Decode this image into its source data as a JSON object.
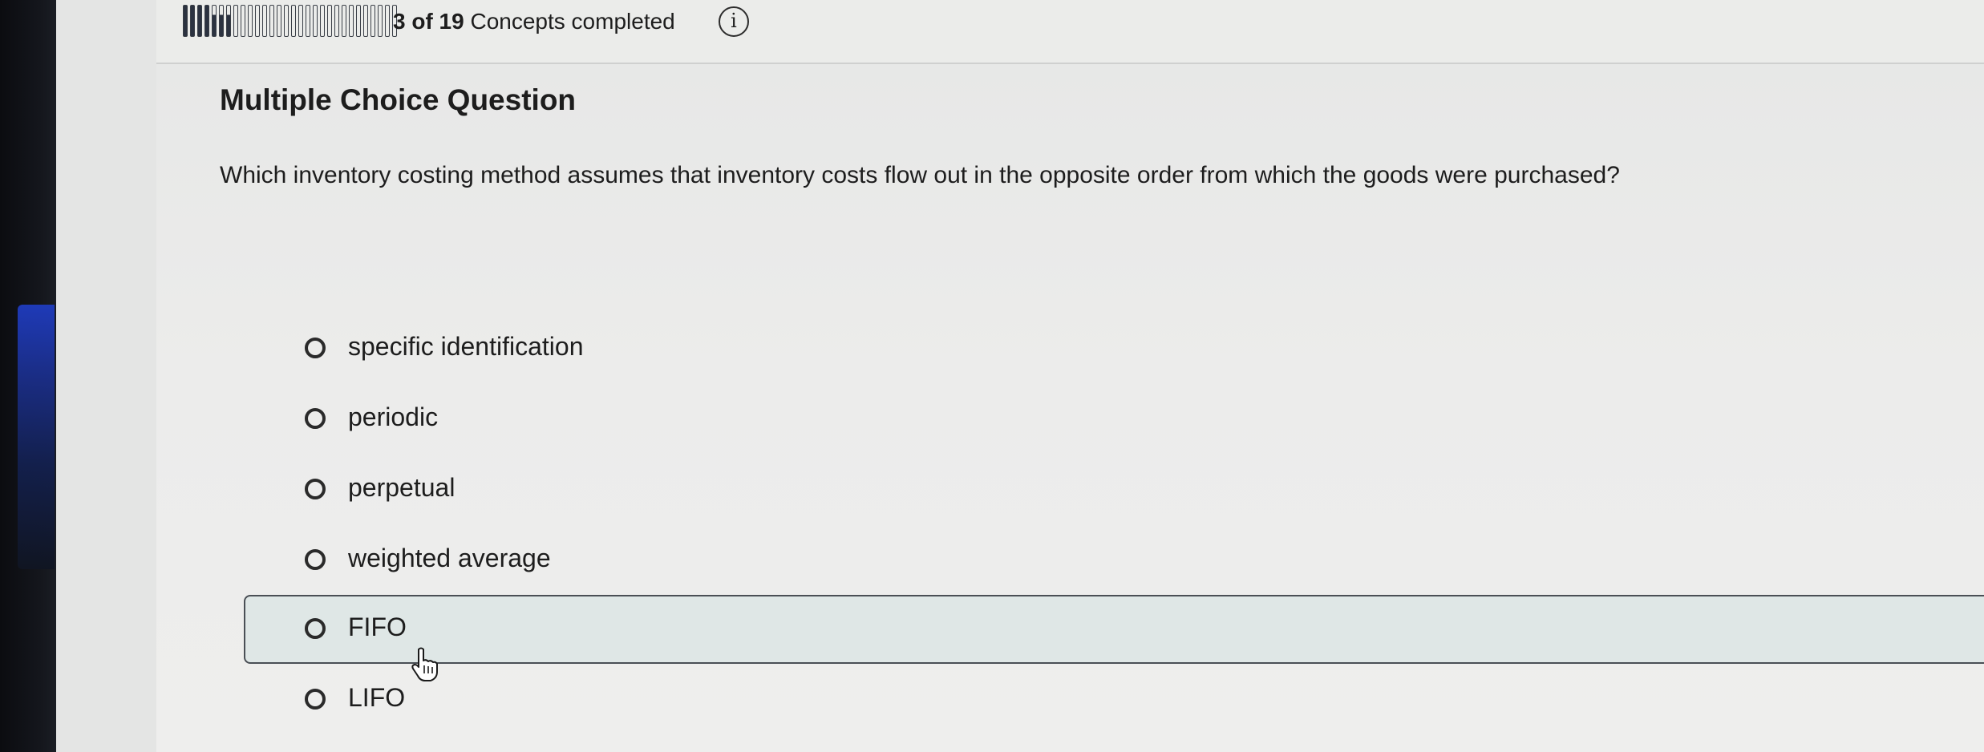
{
  "header": {
    "progress_bold": "3 of 19",
    "progress_rest": " Concepts completed",
    "progress": {
      "completed": 3,
      "total": 19
    },
    "info_glyph": "i"
  },
  "question": {
    "title": "Multiple Choice Question",
    "text": "Which inventory costing method assumes that inventory costs flow out in the opposite order from which the goods were purchased?"
  },
  "options": [
    {
      "label": "specific identification",
      "highlighted": false
    },
    {
      "label": "periodic",
      "highlighted": false
    },
    {
      "label": "perpetual",
      "highlighted": false
    },
    {
      "label": "weighted average",
      "highlighted": false
    },
    {
      "label": "FIFO",
      "highlighted": true
    },
    {
      "label": "LIFO",
      "highlighted": false
    }
  ],
  "icons": {
    "info": "info-icon",
    "cursor": "hand-pointer-icon"
  },
  "colors": {
    "highlight_bg": "#dfe7e6",
    "progress_fill": "#2b3240",
    "text": "#1d1d1d"
  }
}
